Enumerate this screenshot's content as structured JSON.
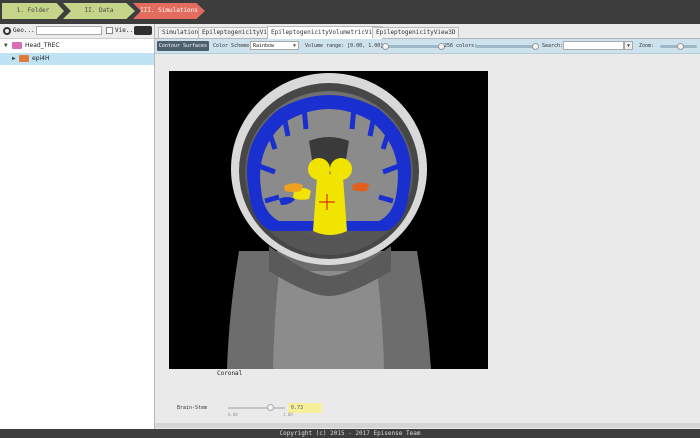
{
  "breadcrumbs": [
    "1. Folder",
    "II. Data",
    "III. Simulations"
  ],
  "left_toolbar": {
    "label": "Geo...",
    "view_label": "Vie..."
  },
  "tree": [
    {
      "label": "Head_TREC",
      "icon": "head-icon",
      "color": "#d86fb6"
    },
    {
      "label": "epi4H",
      "icon": "simulation-icon",
      "color": "#e07b3a"
    }
  ],
  "tabs": [
    {
      "label": "Simulation",
      "active": false
    },
    {
      "label": "EpileptogenicityView",
      "active": false
    },
    {
      "label": "EpileptogenicityVolumetricView",
      "active": true
    },
    {
      "label": "EpileptogenicityView3D",
      "active": false
    }
  ],
  "toolbar": {
    "contour_label": "Contour Surfaces",
    "color_scheme_label": "Color Scheme:",
    "color_scheme_value": "Rainbow",
    "volume_range_label": "Volume range: [0.00, 1.00]",
    "colors_label": "256 colors:",
    "search_label": "Search:",
    "zoom_label": "Zoom:"
  },
  "viewer": {
    "view_label": "Coronal"
  },
  "brain_stem": {
    "label": "Brain-Stem",
    "value": "0.73",
    "min": "0.00",
    "max": "1.00"
  },
  "footer": "Copyright (c) 2015 - 2017 Episense Team",
  "colors": {
    "topbar": "#3d3d3d",
    "crumb_active": "#e36c5e",
    "crumb_inactive": "#c4d488",
    "toolbar": "#cde2ec"
  }
}
